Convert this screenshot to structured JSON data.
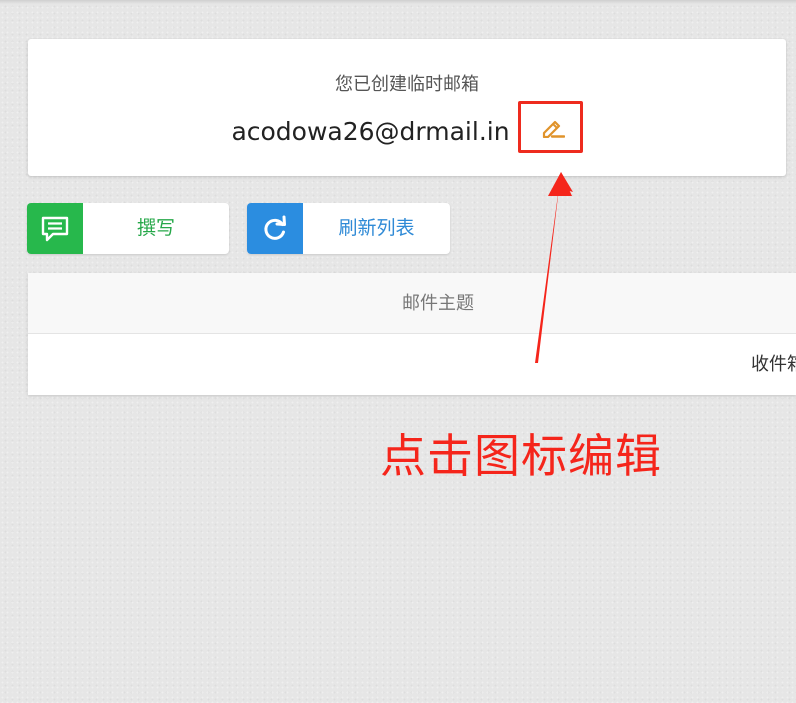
{
  "card": {
    "title": "您已创建临时邮箱",
    "email": "acodowa26@drmail.in",
    "edit_icon": "pencil-icon"
  },
  "buttons": {
    "compose": {
      "label": "撰写",
      "icon": "message-icon",
      "color": "#27b84c"
    },
    "refresh": {
      "label": "刷新列表",
      "icon": "refresh-icon",
      "color": "#2b8de0"
    }
  },
  "table": {
    "header_subject": "邮件主题",
    "row_label": "收件箱"
  },
  "annotation": {
    "text": "点击图标编辑",
    "color": "#f5251b"
  }
}
